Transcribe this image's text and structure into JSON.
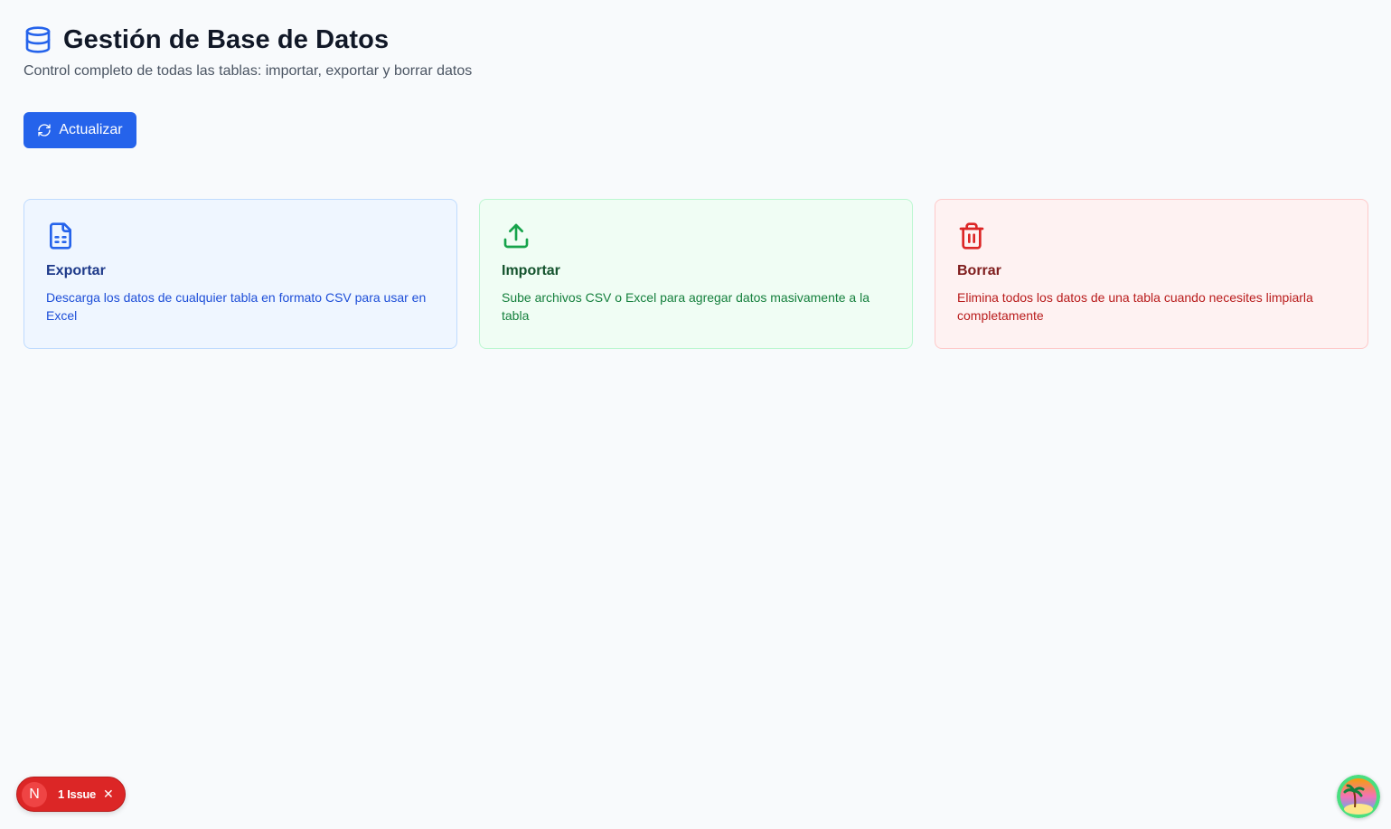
{
  "header": {
    "title": "Gestión de Base de Datos",
    "subtitle": "Control completo de todas las tablas: importar, exportar y borrar datos",
    "icon": "database-icon"
  },
  "toolbar": {
    "refresh_label": "Actualizar",
    "refresh_icon": "refresh-icon"
  },
  "cards": [
    {
      "title": "Exportar",
      "description": "Descarga los datos de cualquier tabla en formato CSV para usar en Excel",
      "icon": "file-spreadsheet-icon",
      "color": "#2563eb"
    },
    {
      "title": "Importar",
      "description": "Sube archivos CSV o Excel para agregar datos masivamente a la tabla",
      "icon": "upload-icon",
      "color": "#16a34a"
    },
    {
      "title": "Borrar",
      "description": "Elimina todos los datos de una tabla cuando necesites limpiarla completamente",
      "icon": "trash-icon",
      "color": "#dc2626"
    }
  ],
  "dev_overlay": {
    "logo_letter": "N",
    "issue_text": "1 Issue",
    "close_symbol": "✕"
  },
  "colors": {
    "primary": "#2563eb",
    "background": "#f8fafc"
  }
}
